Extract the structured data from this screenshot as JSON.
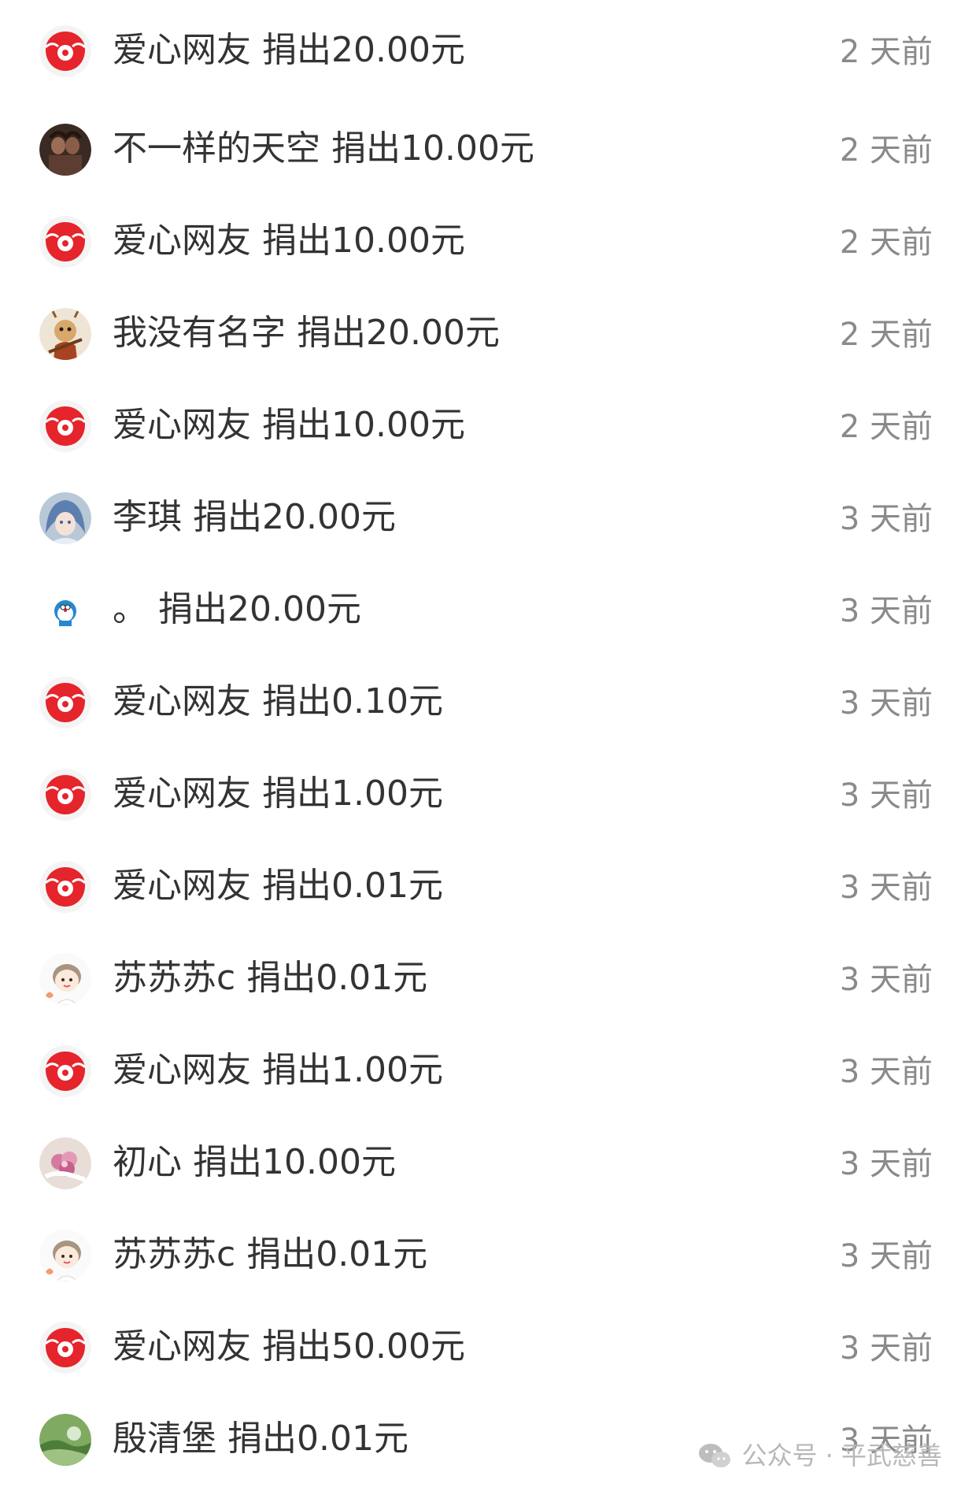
{
  "donations": [
    {
      "avatar": "love-netizen-avatar",
      "name": "爱心网友",
      "amount": "捐出20.00元",
      "time": "2 天前"
    },
    {
      "avatar": "user-photo-avatar",
      "name": "不一样的天空",
      "amount": "捐出10.00元",
      "time": "2 天前"
    },
    {
      "avatar": "love-netizen-avatar",
      "name": "爱心网友",
      "amount": "捐出10.00元",
      "time": "2 天前"
    },
    {
      "avatar": "monkey-king-avatar",
      "name": "我没有名字",
      "amount": "捐出20.00元",
      "time": "2 天前"
    },
    {
      "avatar": "love-netizen-avatar",
      "name": "爱心网友",
      "amount": "捐出10.00元",
      "time": "2 天前"
    },
    {
      "avatar": "anime-girl-avatar",
      "name": "李琪",
      "amount": "捐出20.00元",
      "time": "3 天前"
    },
    {
      "avatar": "doraemon-avatar",
      "name": "。",
      "amount": "捐出20.00元",
      "time": "3 天前"
    },
    {
      "avatar": "love-netizen-avatar",
      "name": "爱心网友",
      "amount": "捐出0.10元",
      "time": "3 天前"
    },
    {
      "avatar": "love-netizen-avatar",
      "name": "爱心网友",
      "amount": "捐出1.00元",
      "time": "3 天前"
    },
    {
      "avatar": "love-netizen-avatar",
      "name": "爱心网友",
      "amount": "捐出0.01元",
      "time": "3 天前"
    },
    {
      "avatar": "cartoon-boy-avatar",
      "name": "苏苏苏c",
      "amount": "捐出0.01元",
      "time": "3 天前"
    },
    {
      "avatar": "love-netizen-avatar",
      "name": "爱心网友",
      "amount": "捐出1.00元",
      "time": "3 天前"
    },
    {
      "avatar": "flower-avatar",
      "name": "初心",
      "amount": "捐出10.00元",
      "time": "3 天前"
    },
    {
      "avatar": "cartoon-boy-avatar",
      "name": "苏苏苏c",
      "amount": "捐出0.01元",
      "time": "3 天前"
    },
    {
      "avatar": "love-netizen-avatar",
      "name": "爱心网友",
      "amount": "捐出50.00元",
      "time": "3 天前"
    },
    {
      "avatar": "landscape-avatar",
      "name": "殷清堡",
      "amount": "捐出0.01元",
      "time": "3 天前"
    }
  ],
  "watermark": {
    "icon": "wechat-icon",
    "text": "公众号 · 平武慈善"
  },
  "colors": {
    "name_text": "#333333",
    "time_text": "#8a8a8a",
    "love_avatar_red": "#e5242b",
    "watermark": "#b8b8b8"
  }
}
